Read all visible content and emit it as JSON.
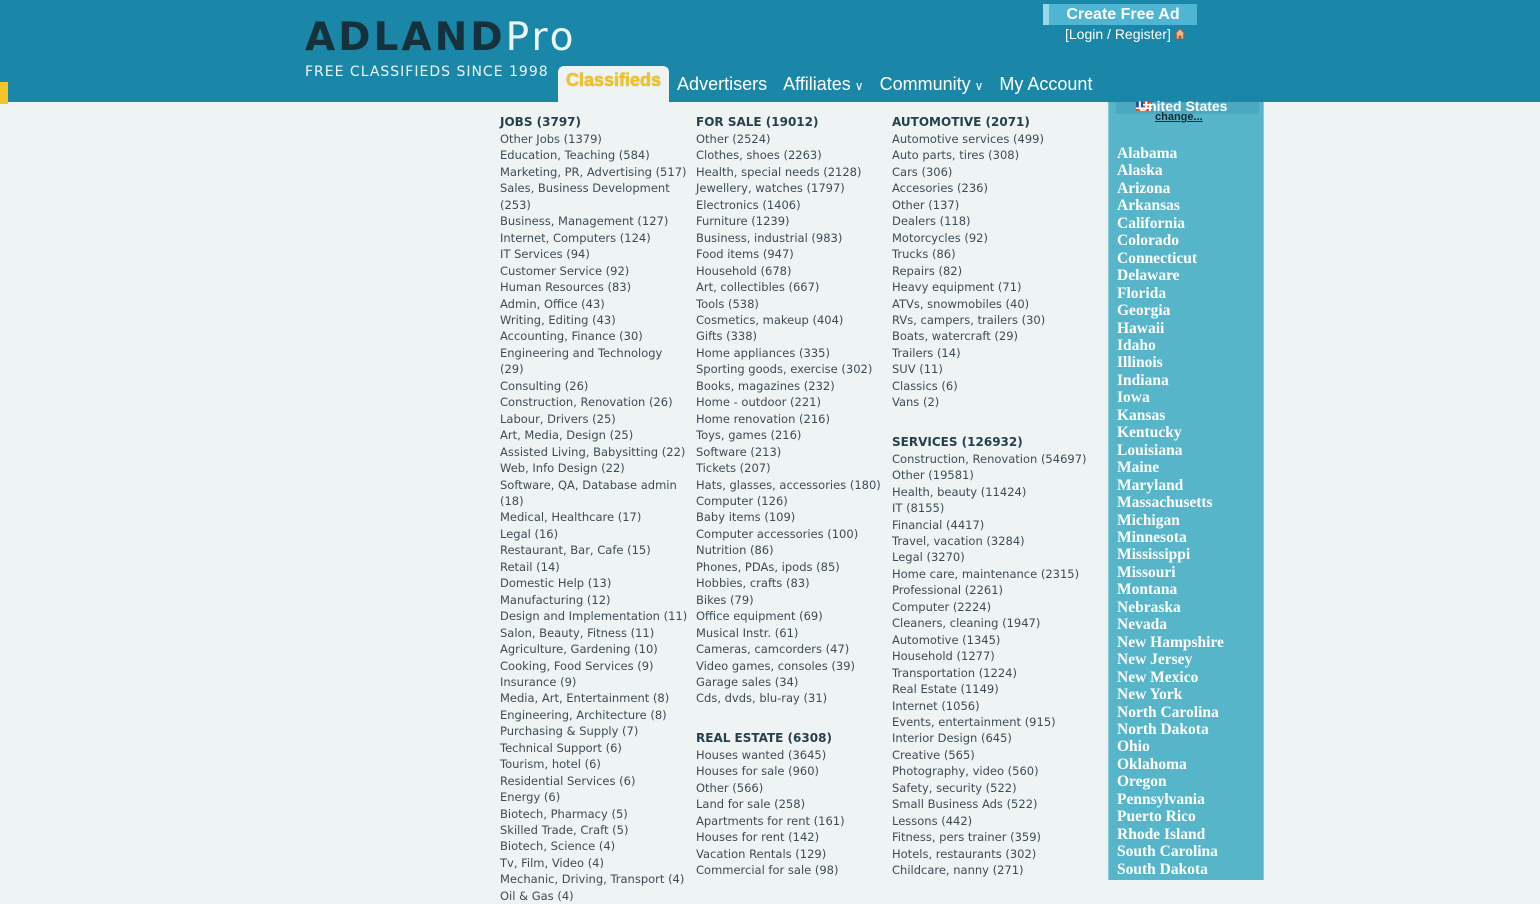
{
  "header": {
    "logo_part1": "ADLAND",
    "logo_part2": "Pro",
    "tagline": "FREE CLASSIFIEDS SINCE 1998",
    "create_ad": "Create Free Ad",
    "login": "[Login / Register]"
  },
  "nav": [
    {
      "label": "Classifieds"
    },
    {
      "label": "Advertisers"
    },
    {
      "label": "Affiliates",
      "caret": "∨"
    },
    {
      "label": "Community",
      "caret": "∨"
    },
    {
      "label": "My Account"
    }
  ],
  "columns": [
    {
      "categories": [
        {
          "title": "JOBS (3797)",
          "items": [
            "Other Jobs (1379)",
            "Education, Teaching (584)",
            "Marketing, PR, Advertising (517)",
            "Sales, Business Development (253)",
            "Business, Management (127)",
            "Internet, Computers (124)",
            "IT Services (94)",
            "Customer Service (92)",
            "Human Resources (83)",
            "Admin, Office (43)",
            "Writing, Editing (43)",
            "Accounting, Finance (30)",
            "Engineering and Technology (29)",
            "Consulting (26)",
            "Construction, Renovation (26)",
            "Labour, Drivers (25)",
            "Art, Media, Design (25)",
            "Assisted Living, Babysitting (22)",
            "Web, Info Design (22)",
            "Software, QA, Database admin (18)",
            "Medical, Healthcare (17)",
            "Legal (16)",
            "Restaurant, Bar, Cafe (15)",
            "Retail (14)",
            "Domestic Help (13)",
            "Manufacturing (12)",
            "Design and Implementation (11)",
            "Salon, Beauty, Fitness (11)",
            "Agriculture, Gardening (10)",
            "Cooking, Food Services (9)",
            "Insurance (9)",
            "Media, Art, Entertainment (8)",
            "Engineering, Architecture (8)",
            "Purchasing & Supply (7)",
            "Technical Support (6)",
            "Tourism, hotel (6)",
            "Residential Services (6)",
            "Energy (6)",
            "Biotech, Pharmacy (5)",
            "Skilled Trade, Craft (5)",
            "Biotech, Science (4)",
            "Tv, Film, Video (4)",
            "Mechanic, Driving, Transport (4)",
            "Oil & Gas (4)"
          ]
        }
      ]
    },
    {
      "categories": [
        {
          "title": "FOR SALE (19012)",
          "items": [
            "Other (2524)",
            "Clothes, shoes (2263)",
            "Health, special needs (2128)",
            "Jewellery, watches (1797)",
            "Electronics (1406)",
            "Furniture (1239)",
            "Business, industrial (983)",
            "Food items (947)",
            "Household (678)",
            "Art, collectibles (667)",
            "Tools (538)",
            "Cosmetics, makeup (404)",
            "Gifts (338)",
            "Home appliances (335)",
            "Sporting goods, exercise (302)",
            "Books, magazines (232)",
            "Home - outdoor (221)",
            "Home renovation (216)",
            "Toys, games (216)",
            "Software (213)",
            "Tickets (207)",
            "Hats, glasses, accessories (180)",
            "Computer (126)",
            "Baby items (109)",
            "Computer accessories (100)",
            "Nutrition (86)",
            "Phones, PDAs, ipods (85)",
            "Hobbies, crafts (83)",
            "Bikes (79)",
            "Office equipment (69)",
            "Musical Instr. (61)",
            "Cameras, camcorders (47)",
            "Video games, consoles (39)",
            "Garage sales (34)",
            "Cds, dvds, blu-ray (31)"
          ]
        },
        {
          "title": "REAL ESTATE (6308)",
          "items": [
            "Houses wanted (3645)",
            "Houses for sale (960)",
            "Other (566)",
            "Land for sale (258)",
            "Apartments for rent (161)",
            "Houses for rent (142)",
            "Vacation Rentals (129)",
            "Commercial for sale (98)"
          ]
        }
      ]
    },
    {
      "categories": [
        {
          "title": "AUTOMOTIVE (2071)",
          "items": [
            "Automotive services (499)",
            "Auto parts, tires (308)",
            "Cars (306)",
            "Accesories (236)",
            "Other (137)",
            "Dealers (118)",
            "Motorcycles (92)",
            "Trucks (86)",
            "Repairs (82)",
            "Heavy equipment (71)",
            "ATVs, snowmobiles (40)",
            "RVs, campers, trailers (30)",
            "Boats, watercraft (29)",
            "Trailers (14)",
            "SUV (11)",
            "Classics (6)",
            "Vans (2)"
          ]
        },
        {
          "title": "SERVICES (126932)",
          "items": [
            "Construction, Renovation (54697)",
            "Other (19581)",
            "Health, beauty (11424)",
            "IT (8155)",
            "Financial (4417)",
            "Travel, vacation (3284)",
            "Legal (3270)",
            "Home care, maintenance (2315)",
            "Professional (2261)",
            "Computer (2224)",
            "Cleaners, cleaning (1947)",
            "Automotive (1345)",
            "Household (1277)",
            "Transportation (1224)",
            "Real Estate (1149)",
            "Internet (1056)",
            "Events, entertainment (915)",
            "Interior Design (645)",
            "Creative (565)",
            "Photography, video (560)",
            "Safety, security (522)",
            "Small Business Ads (522)",
            "Lessons (442)",
            "Fitness, pers trainer (359)",
            "Hotels, restaurants (302)",
            "Childcare, nanny (271)"
          ]
        }
      ]
    }
  ],
  "sidebar": {
    "country": "United States",
    "change": "change...",
    "states": [
      "Alabama",
      "Alaska",
      "Arizona",
      "Arkansas",
      "California",
      "Colorado",
      "Connecticut",
      "Delaware",
      "Florida",
      "Georgia",
      "Hawaii",
      "Idaho",
      "Illinois",
      "Indiana",
      "Iowa",
      "Kansas",
      "Kentucky",
      "Louisiana",
      "Maine",
      "Maryland",
      "Massachusetts",
      "Michigan",
      "Minnesota",
      "Mississippi",
      "Missouri",
      "Montana",
      "Nebraska",
      "Nevada",
      "New Hampshire",
      "New Jersey",
      "New Mexico",
      "New York",
      "North Carolina",
      "North Dakota",
      "Ohio",
      "Oklahoma",
      "Oregon",
      "Pennsylvania",
      "Puerto Rico",
      "Rhode Island",
      "South Carolina",
      "South Dakota"
    ]
  }
}
